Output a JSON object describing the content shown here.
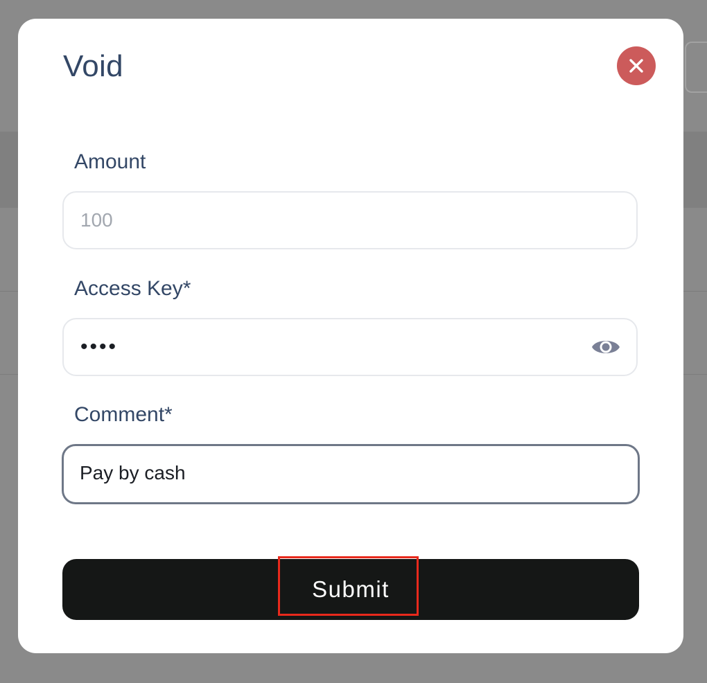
{
  "dialog": {
    "title": "Void",
    "close_icon": "close-icon",
    "close_color": "#cc5b5b"
  },
  "fields": {
    "amount": {
      "label": "Amount",
      "value": "",
      "placeholder": "100"
    },
    "access_key": {
      "label": "Access Key*",
      "value": "1234",
      "type": "password",
      "toggle_icon": "eye-icon"
    },
    "comment": {
      "label": "Comment*",
      "value": "Pay by cash",
      "focused": true
    }
  },
  "submit": {
    "label": "Submit",
    "background": "#151716",
    "highlight_color": "#e8291c"
  },
  "colors": {
    "label_text": "#334766",
    "backdrop": "#8a8a8a"
  }
}
